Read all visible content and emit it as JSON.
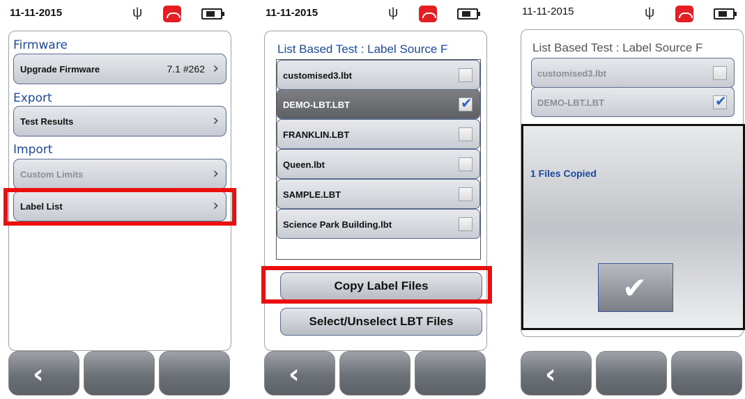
{
  "panel1": {
    "date": "11-11-2015",
    "sections": {
      "firmware": "Firmware",
      "export": "Export",
      "import": "Import"
    },
    "rows": {
      "upgrade_firmware": {
        "label": "Upgrade Firmware",
        "value": "7.1  #262"
      },
      "test_results": {
        "label": "Test Results"
      },
      "custom_limits": {
        "label": "Custom Limits"
      },
      "label_list": {
        "label": "Label List"
      }
    }
  },
  "panel2": {
    "date": "11-11-2015",
    "title": "List Based Test : Label Source F",
    "files": [
      {
        "name": "customised3.lbt",
        "checked": false
      },
      {
        "name": "DEMO-LBT.LBT",
        "checked": true
      },
      {
        "name": "FRANKLIN.LBT",
        "checked": false
      },
      {
        "name": "Queen.lbt",
        "checked": false
      },
      {
        "name": "SAMPLE.LBT",
        "checked": false
      },
      {
        "name": "Science Park Building.lbt",
        "checked": false
      }
    ],
    "copy_button": "Copy Label Files",
    "select_button": "Select/Unselect LBT Files"
  },
  "panel3": {
    "date": "11-11-2015",
    "title": "List Based Test : Label Source F",
    "files": [
      {
        "name": "customised3.lbt",
        "checked": false
      },
      {
        "name": "DEMO-LBT.LBT",
        "checked": true
      }
    ],
    "dialog_message": "1 Files Copied"
  },
  "icons": {
    "usb": "usb-icon",
    "phone": "phone-hangup-icon",
    "battery": "battery-icon",
    "back": "back-arrow-icon",
    "check": "checkmark-icon"
  },
  "colors": {
    "accent": "#1b4aa1",
    "highlight": "#ea1010",
    "phone": "#e51e24"
  }
}
